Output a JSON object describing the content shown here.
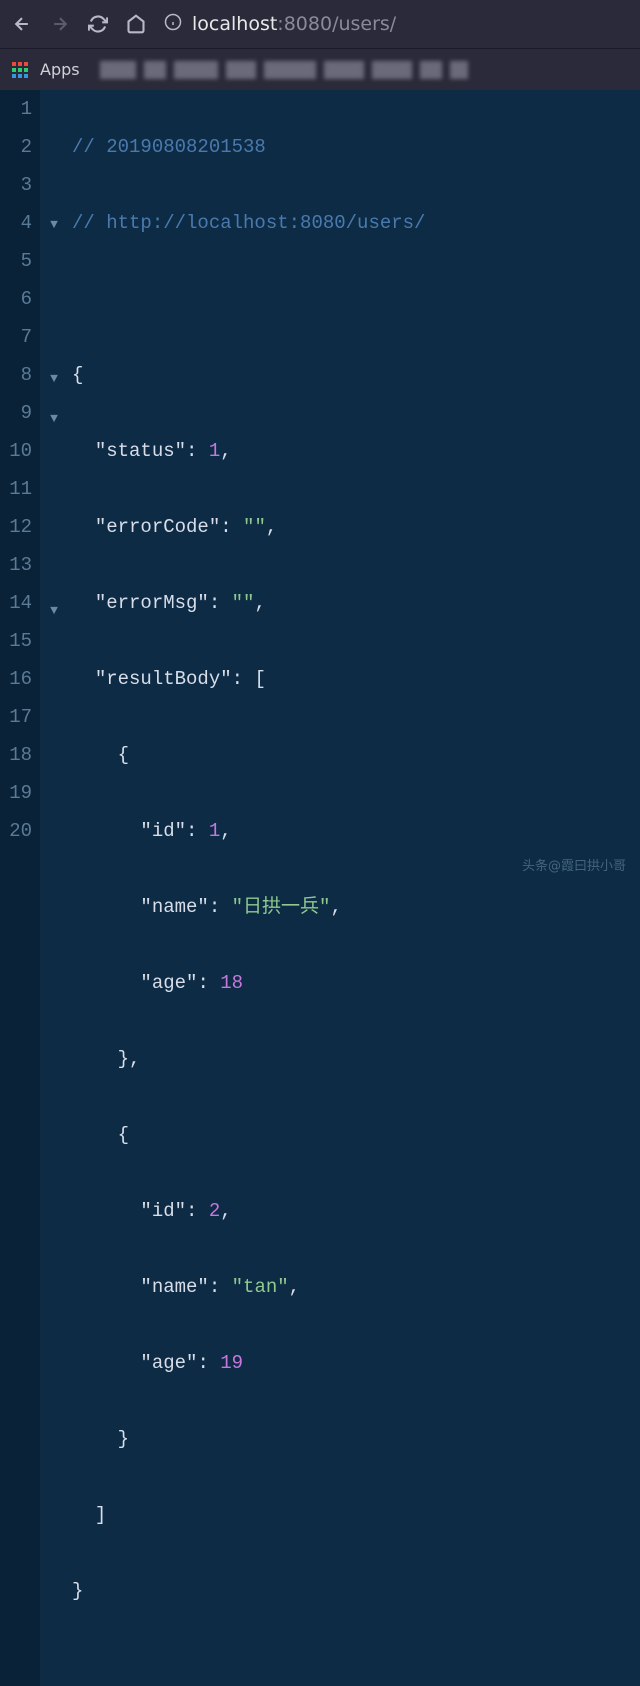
{
  "browser": {
    "url_host": "localhost",
    "url_port": ":8080",
    "url_path": "/users/"
  },
  "bookmarks": {
    "apps_label": "Apps"
  },
  "code": {
    "line_numbers": [
      "1",
      "2",
      "3",
      "4",
      "5",
      "6",
      "7",
      "8",
      "9",
      "10",
      "11",
      "12",
      "13",
      "14",
      "15",
      "16",
      "17",
      "18",
      "19",
      "20"
    ],
    "fold_markers": [
      "",
      "",
      "",
      "▼",
      "",
      "",
      "",
      "▼",
      "▼",
      "",
      "",
      "",
      "",
      "▼",
      "",
      "",
      "",
      "",
      "",
      ""
    ],
    "comment1": "// 20190808201538",
    "comment2": "// http://localhost:8080/users/",
    "json": {
      "status": 1,
      "errorCode": "",
      "errorMsg": "",
      "resultBody": [
        {
          "id": 1,
          "name": "日拱一兵",
          "age": 18
        },
        {
          "id": 2,
          "name": "tan",
          "age": 19
        }
      ]
    },
    "keys": {
      "status": "\"status\"",
      "errorCode": "\"errorCode\"",
      "errorMsg": "\"errorMsg\"",
      "resultBody": "\"resultBody\"",
      "id": "\"id\"",
      "name": "\"name\"",
      "age": "\"age\""
    },
    "values": {
      "status": "1",
      "errorCode": "\"\"",
      "errorMsg": "\"\"",
      "id1": "1",
      "name1": "\"日拱一兵\"",
      "age1": "18",
      "id2": "2",
      "name2": "\"tan\"",
      "age2": "19"
    }
  },
  "watermark": "头条@霞曰拱小哥"
}
